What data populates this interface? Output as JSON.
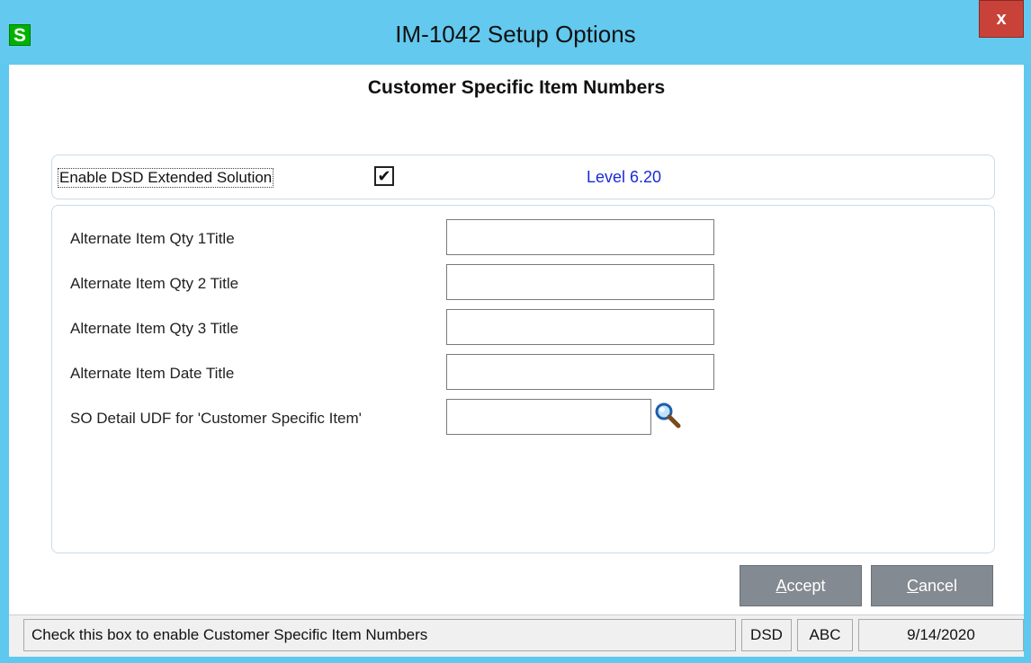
{
  "window": {
    "app_icon": "S",
    "title": "IM-1042 Setup Options",
    "close_label": "x"
  },
  "heading": "Customer Specific Item Numbers",
  "enable": {
    "label": "Enable DSD Extended Solution",
    "checked": true,
    "check_glyph": "✔",
    "level": "Level  6.20"
  },
  "fields": [
    {
      "label": "Alternate Item Qty 1Title",
      "value": ""
    },
    {
      "label": "Alternate Item Qty 2 Title",
      "value": ""
    },
    {
      "label": "Alternate Item Qty 3 Title",
      "value": ""
    },
    {
      "label": "Alternate Item Date Title",
      "value": ""
    },
    {
      "label": "SO Detail UDF for 'Customer Specific Item'",
      "value": "",
      "icon": "magnifier-icon"
    }
  ],
  "buttons": {
    "accept": "Accept",
    "cancel": "Cancel"
  },
  "status": {
    "message": "Check this box to enable Customer Specific Item Numbers",
    "module": "DSD",
    "company": "ABC",
    "date": "9/14/2020"
  },
  "colors": {
    "titlebar": "#63c9ee",
    "button": "#848a91",
    "level_text": "#1a2bd6",
    "app_icon": "#00b200",
    "close": "#c9423a"
  }
}
